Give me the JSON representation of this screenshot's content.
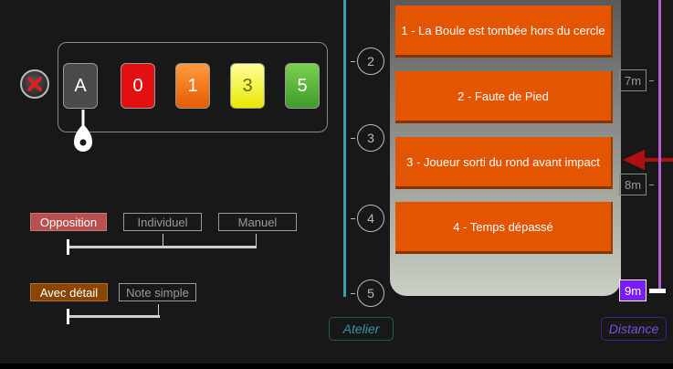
{
  "scores": [
    "A",
    "0",
    "1",
    "3",
    "5"
  ],
  "mode": {
    "options": [
      "Opposition",
      "Individuel",
      "Manuel"
    ],
    "selected": "Opposition"
  },
  "detail": {
    "options": [
      "Avec détail",
      "Note simple"
    ],
    "selected": "Avec détail"
  },
  "atelier": {
    "label": "Atelier",
    "steps": [
      "2",
      "3",
      "4",
      "5"
    ]
  },
  "faults": [
    "1 - La Boule est tombée hors du cercle",
    "2 - Faute de Pied",
    "3 - Joueur sorti du rond avant impact",
    "4 - Temps dépassé"
  ],
  "distance": {
    "label": "Distance",
    "marks": [
      "7m",
      "8m",
      "9m"
    ],
    "selected": "9m"
  },
  "colors": {
    "accent_orange": "#e35500",
    "atelier_teal": "#37a0a8",
    "distance_purple": "#b25ed0",
    "arrow_red": "#b01010"
  },
  "icons": {
    "close": "close-icon",
    "pin": "map-pin-icon",
    "arrow": "arrow-left-icon"
  }
}
